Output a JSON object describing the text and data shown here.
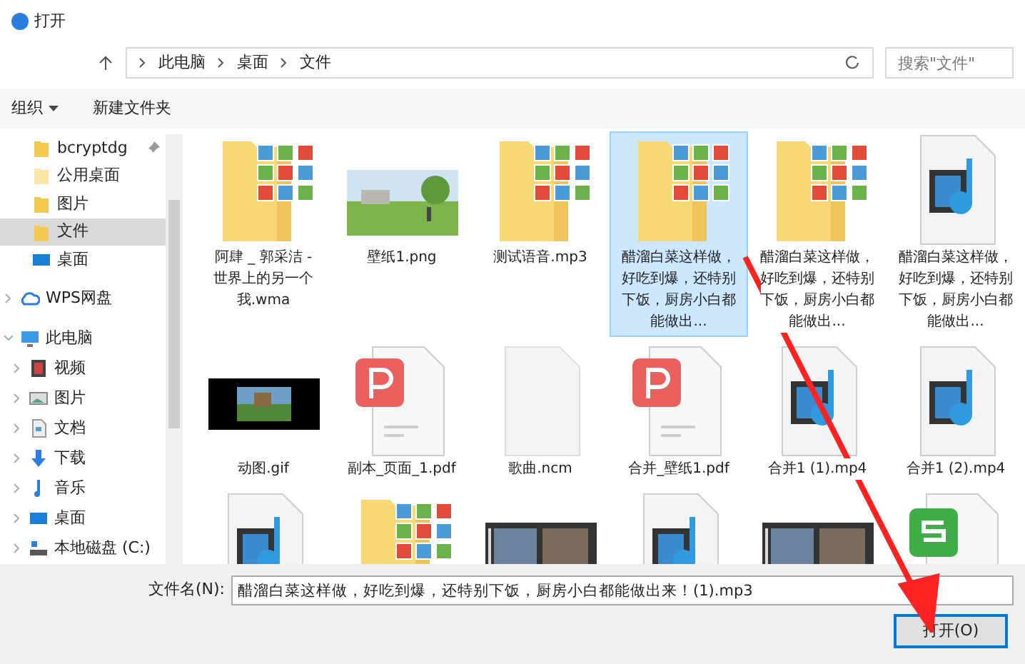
{
  "window": {
    "title": "打开"
  },
  "address": {
    "path": [
      "此电脑",
      "桌面",
      "文件"
    ],
    "search_placeholder": "搜索\"文件\""
  },
  "toolbar": {
    "organize": "组织",
    "new_folder": "新建文件夹"
  },
  "nav": [
    {
      "label": "bcryptdg",
      "kind": "folder",
      "pinned": true,
      "selected": false
    },
    {
      "label": "公用桌面",
      "kind": "folder-light",
      "pinned": false,
      "selected": false
    },
    {
      "label": "图片",
      "kind": "folder",
      "pinned": false,
      "selected": false
    },
    {
      "label": "文件",
      "kind": "folder",
      "pinned": false,
      "selected": true
    },
    {
      "label": "桌面",
      "kind": "desktop",
      "pinned": false,
      "selected": false
    }
  ],
  "nav_roots": [
    {
      "label": "WPS网盘",
      "kind": "cloud",
      "expanded": false
    },
    {
      "label": "此电脑",
      "kind": "computer",
      "expanded": true,
      "children": [
        {
          "label": "视频",
          "kind": "video",
          "expanded": false
        },
        {
          "label": "图片",
          "kind": "pictures",
          "expanded": false
        },
        {
          "label": "文档",
          "kind": "document",
          "expanded": false
        },
        {
          "label": "下载",
          "kind": "download",
          "expanded": false
        },
        {
          "label": "音乐",
          "kind": "music",
          "expanded": false
        },
        {
          "label": "桌面",
          "kind": "desktop",
          "expanded": false
        },
        {
          "label": "本地磁盘 (C:)",
          "kind": "drive",
          "expanded": false
        }
      ]
    }
  ],
  "files": [
    {
      "name": "阿肆 _ 郭采洁 - 世界上的另一个我.wma",
      "kind": "folder-pictures",
      "selected": false
    },
    {
      "name": "壁纸1.png",
      "selected": false
    },
    {
      "name": "测试语音.mp3",
      "kind": "folder-pictures",
      "selected": false
    },
    {
      "name": "醋溜白菜这样做，好吃到爆，还特别下饭，厨房小白都能做出...",
      "kind": "folder-pictures",
      "selected": true
    },
    {
      "name": "醋溜白菜这样做，好吃到爆，还特别下饭，厨房小白都能做出...",
      "kind": "folder-pictures",
      "selected": false
    },
    {
      "name": "醋溜白菜这样做，好吃到爆，还特别下饭，厨房小白都能做出...",
      "kind": "media",
      "selected": false
    },
    {
      "name": "动图.gif",
      "kind": "gif",
      "selected": false
    },
    {
      "name": "副本_页面_1.pdf",
      "kind": "pdf",
      "selected": false
    },
    {
      "name": "歌曲.ncm",
      "kind": "blank",
      "selected": false
    },
    {
      "name": "合并_壁纸1.pdf",
      "kind": "pdf",
      "selected": false
    },
    {
      "name": "合并1 (1).mp4",
      "kind": "media",
      "selected": false
    },
    {
      "name": "合并1 (2).mp4",
      "kind": "media",
      "selected": false
    },
    {
      "kind": "media",
      "selected": false
    },
    {
      "kind": "folder-pictures",
      "selected": false
    },
    {
      "kind": "filmstrip",
      "selected": false
    },
    {
      "kind": "media",
      "selected": false
    },
    {
      "kind": "filmstrip",
      "selected": false
    },
    {
      "kind": "spreadsheet",
      "selected": false
    }
  ],
  "footer": {
    "filename_label": "文件名(N):",
    "filename": "醋溜白菜这样做，好吃到爆，还特别下饭，厨房小白都能做出来！(1).mp3",
    "open_button": "打开(O)"
  }
}
